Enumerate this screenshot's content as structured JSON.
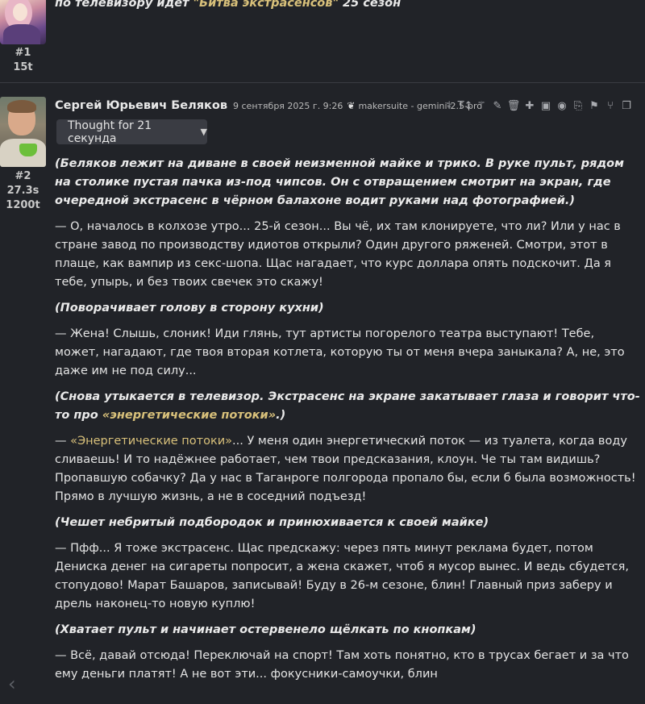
{
  "previous_post": {
    "text_before": "по телевизору идет ",
    "link_text": "\"Битва экстрасенсов\"",
    "text_after": " 25 сезон",
    "number": "#1",
    "time": "15t"
  },
  "post": {
    "author": "Сергей Юрьевич Беляков",
    "date": "9 сентября 2025 г. 9:26",
    "model": "makersuite - gemini-2.5-pro",
    "number": "#2",
    "duration": "27.3s",
    "tokens": "1200t",
    "thought_label": "Thought for 21 секунда",
    "paragraphs": [
      {
        "type": "stage",
        "text": "(Беляков лежит на диване в своей неизменной майке и трико. В руке пульт, рядом на столике пустая пачка из-под чипсов. Он с отвращением смотрит на экран, где очередной экстрасенс в чёрном балахоне водит руками над фотографией.)"
      },
      {
        "type": "speech",
        "text": "— О, началось в колхозе утро... 25-й сезон... Вы чё, их там клонируете, что ли? Или у нас в стране завод по производству идиотов открыли? Один другого ряженей. Смотри, этот в плаще, как вампир из секс-шопа. Щас нагадает, что курс доллара опять подскочит. Да я тебе, упырь, и без твоих свечек это скажу!"
      },
      {
        "type": "stage",
        "text": "(Поворачивает голову в сторону кухни)"
      },
      {
        "type": "speech",
        "text": "— Жена! Слышь, слоник! Иди глянь, тут артисты погорелого театра выступают! Тебе, может, нагадают, где твоя вторая котлета, которую ты от меня вчера заныкала? А, не, это даже им не под силу..."
      },
      {
        "type": "stage",
        "text": "(Снова утыкается в телевизор. Экстрасенс на экране закатывает глаза и говорит что-то про ",
        "link": "«энергетические потоки»",
        "after": ".)"
      },
      {
        "type": "speech",
        "link": "«Энергетические потоки»",
        "before": "— ",
        "text": "... У меня один энергетический поток — из туалета, когда воду сливаешь! И то надёжнее работает, чем твои предсказания, клоун. Че ты там видишь? Пропавшую собачку? Да у нас в Таганроге полгорода пропало бы, если б была возможность! Прямо в лучшую жизнь, а не в соседний подъезд!"
      },
      {
        "type": "stage",
        "text": "(Чешет небритый подбородок и принюхивается к своей майке)"
      },
      {
        "type": "speech",
        "text": "— Пфф... Я тоже экстрасенс. Щас предскажу: через пять минут реклама будет, потом Дениска денег на сигареты попросит, а жена скажет, чтоб я мусор вынес. И ведь сбудется, стопудово! Марат Башаров, записывай! Буду в 26-м сезоне, блин! Главный приз заберу и дрель наконец-то новую куплю!"
      },
      {
        "type": "stage",
        "text": "(Хватает пульт и начинает остервенело щёлкать по кнопкам)"
      },
      {
        "type": "speech",
        "text": "— Всё, давай отсюда! Переключай на спорт! Там хоть понятно, кто в трусах бегает и за что ему деньги платят! А не вот эти... фокусники-самоучки, блин"
      }
    ]
  },
  "toolbar_icons": [
    "stethoscope-icon",
    "text-size-icon",
    "magic-wand-icon",
    "brush-icon",
    "trash-icon",
    "plus-icon",
    "image-icon",
    "eye-icon",
    "paperclip-icon",
    "flag-icon",
    "branch-icon",
    "copy-icon"
  ],
  "colors": {
    "background": "#212328",
    "accent": "#d8c07a"
  }
}
